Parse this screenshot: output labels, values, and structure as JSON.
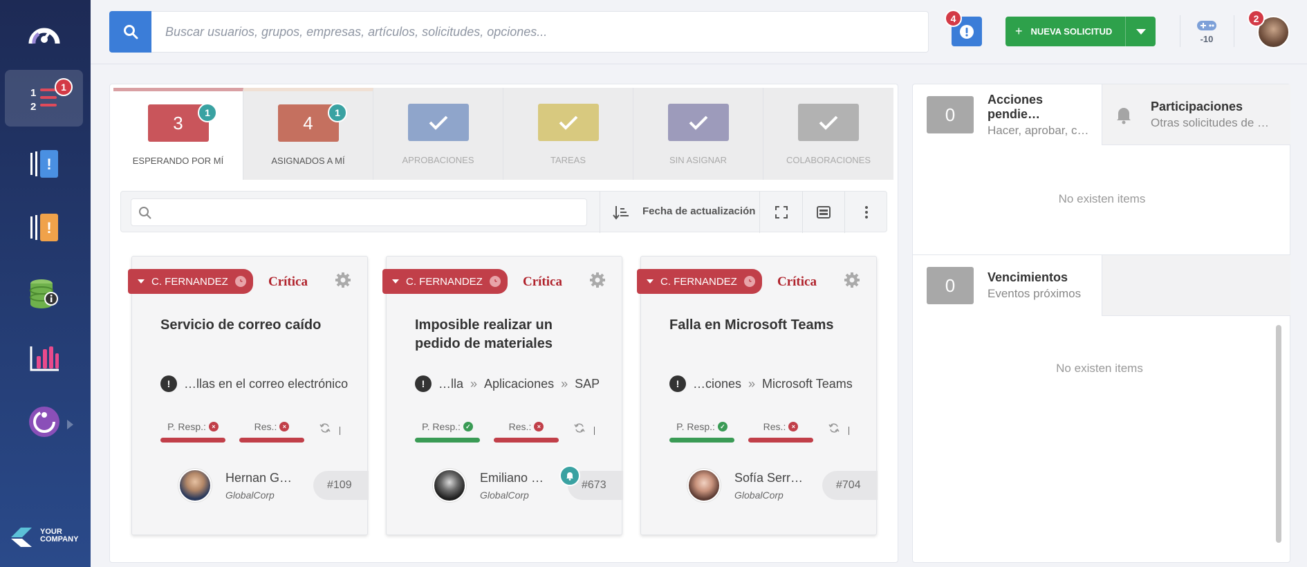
{
  "sidebar": {
    "badge_requests": "1",
    "logo_line1": "YOUR",
    "logo_line2": "COMPANY"
  },
  "topbar": {
    "search_placeholder": "Buscar usuarios, grupos, empresas, artículos, solicitudes, opciones...",
    "alerts_count": "4",
    "new_request_label": "NUEVA SOLICITUD",
    "game_points": "-10",
    "avatar_badge": "2"
  },
  "tabs": [
    {
      "count": "3",
      "label": "ESPERANDO POR MÍ",
      "badge": "1",
      "color": "#c9555b"
    },
    {
      "count": "4",
      "label": "ASIGNADOS A MÍ",
      "badge": "1",
      "color": "#c5705f"
    },
    {
      "label": "APROBACIONES",
      "color": "#8fa5cb"
    },
    {
      "label": "TAREAS",
      "color": "#d8c97f"
    },
    {
      "label": "SIN ASIGNAR",
      "color": "#9d9bbb"
    },
    {
      "label": "COLABORACIONES",
      "color": "#b2b2b2"
    }
  ],
  "filter": {
    "sort_label": "Fecha de actualización"
  },
  "cards": [
    {
      "agent": "C. FERNANDEZ",
      "priority": "Crítica",
      "title": "Servicio de correo caído",
      "path": [
        "…llas en el correo electrónico"
      ],
      "sla_resp_label": "P. Resp.:",
      "sla_res_label": "Res.:",
      "sla_resp_ok": false,
      "sla_res_ok": false,
      "person": "Hernan G…",
      "company": "GlobalCorp",
      "ticket": "#109"
    },
    {
      "agent": "C. FERNANDEZ",
      "priority": "Crítica",
      "title": "Imposible realizar un pedido de materiales",
      "path": [
        "…lla",
        "»",
        "Aplicaciones",
        "»",
        "SAP"
      ],
      "sla_resp_label": "P. Resp.:",
      "sla_res_label": "Res.:",
      "sla_resp_ok": true,
      "sla_res_ok": false,
      "person": "Emiliano …",
      "company": "GlobalCorp",
      "ticket": "#673"
    },
    {
      "agent": "C. FERNANDEZ",
      "priority": "Crítica",
      "title": "Falla en Microsoft Teams",
      "path": [
        "…ciones",
        "»",
        "Microsoft Teams"
      ],
      "sla_resp_label": "P. Resp.:",
      "sla_res_label": "Res.:",
      "sla_resp_ok": true,
      "sla_res_ok": false,
      "person": "Sofía Serr…",
      "company": "GlobalCorp",
      "ticket": "#704"
    }
  ],
  "right_panel": {
    "actions_count": "0",
    "actions_title": "Acciones pendie…",
    "actions_sub": "Hacer, aprobar, c…",
    "part_title": "Participaciones",
    "part_sub": "Otras solicitudes de …",
    "empty1": "No existen items",
    "due_count": "0",
    "due_title": "Vencimientos",
    "due_sub": "Eventos próximos",
    "empty2": "No existen items"
  },
  "colors": {
    "primary": "#3b7dd8",
    "success": "#2ea14b",
    "danger": "#c13f49",
    "badge": "#d33a46",
    "teal": "#3aa2a2"
  }
}
